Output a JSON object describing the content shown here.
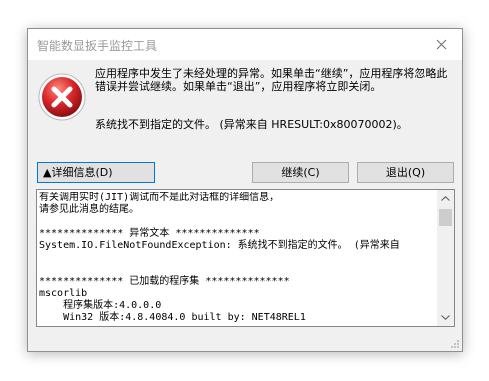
{
  "window": {
    "title": "智能数显扳手监控工具"
  },
  "icons": {
    "error": "error-icon",
    "close": "close-icon"
  },
  "message": {
    "line1": "应用程序中发生了未经处理的异常。如果单击“继续”，应用程序将忽略此错误并尝试继续。如果单击“退出”，应用程序将立即关闭。",
    "line2": "系统找不到指定的文件。 (异常来自 HRESULT:0x80070002)。"
  },
  "buttons": {
    "details": "详细信息(D)",
    "continue": "继续(C)",
    "quit": "退出(Q)"
  },
  "details": {
    "text": "有关调用实时(JIT)调试而不是此对话框的详细信息，\n请参见此消息的结尾。\n\n************** 异常文本 **************\nSystem.IO.FileNotFoundException: 系统找不到指定的文件。 (异常来自\n\n\n************** 已加载的程序集 **************\nmscorlib\n    程序集版本:4.0.0.0\n    Win32 版本:4.8.4084.0 built by: NET48REL1"
  },
  "colors": {
    "error_red": "#d8262b",
    "accent": "#0078d7"
  }
}
